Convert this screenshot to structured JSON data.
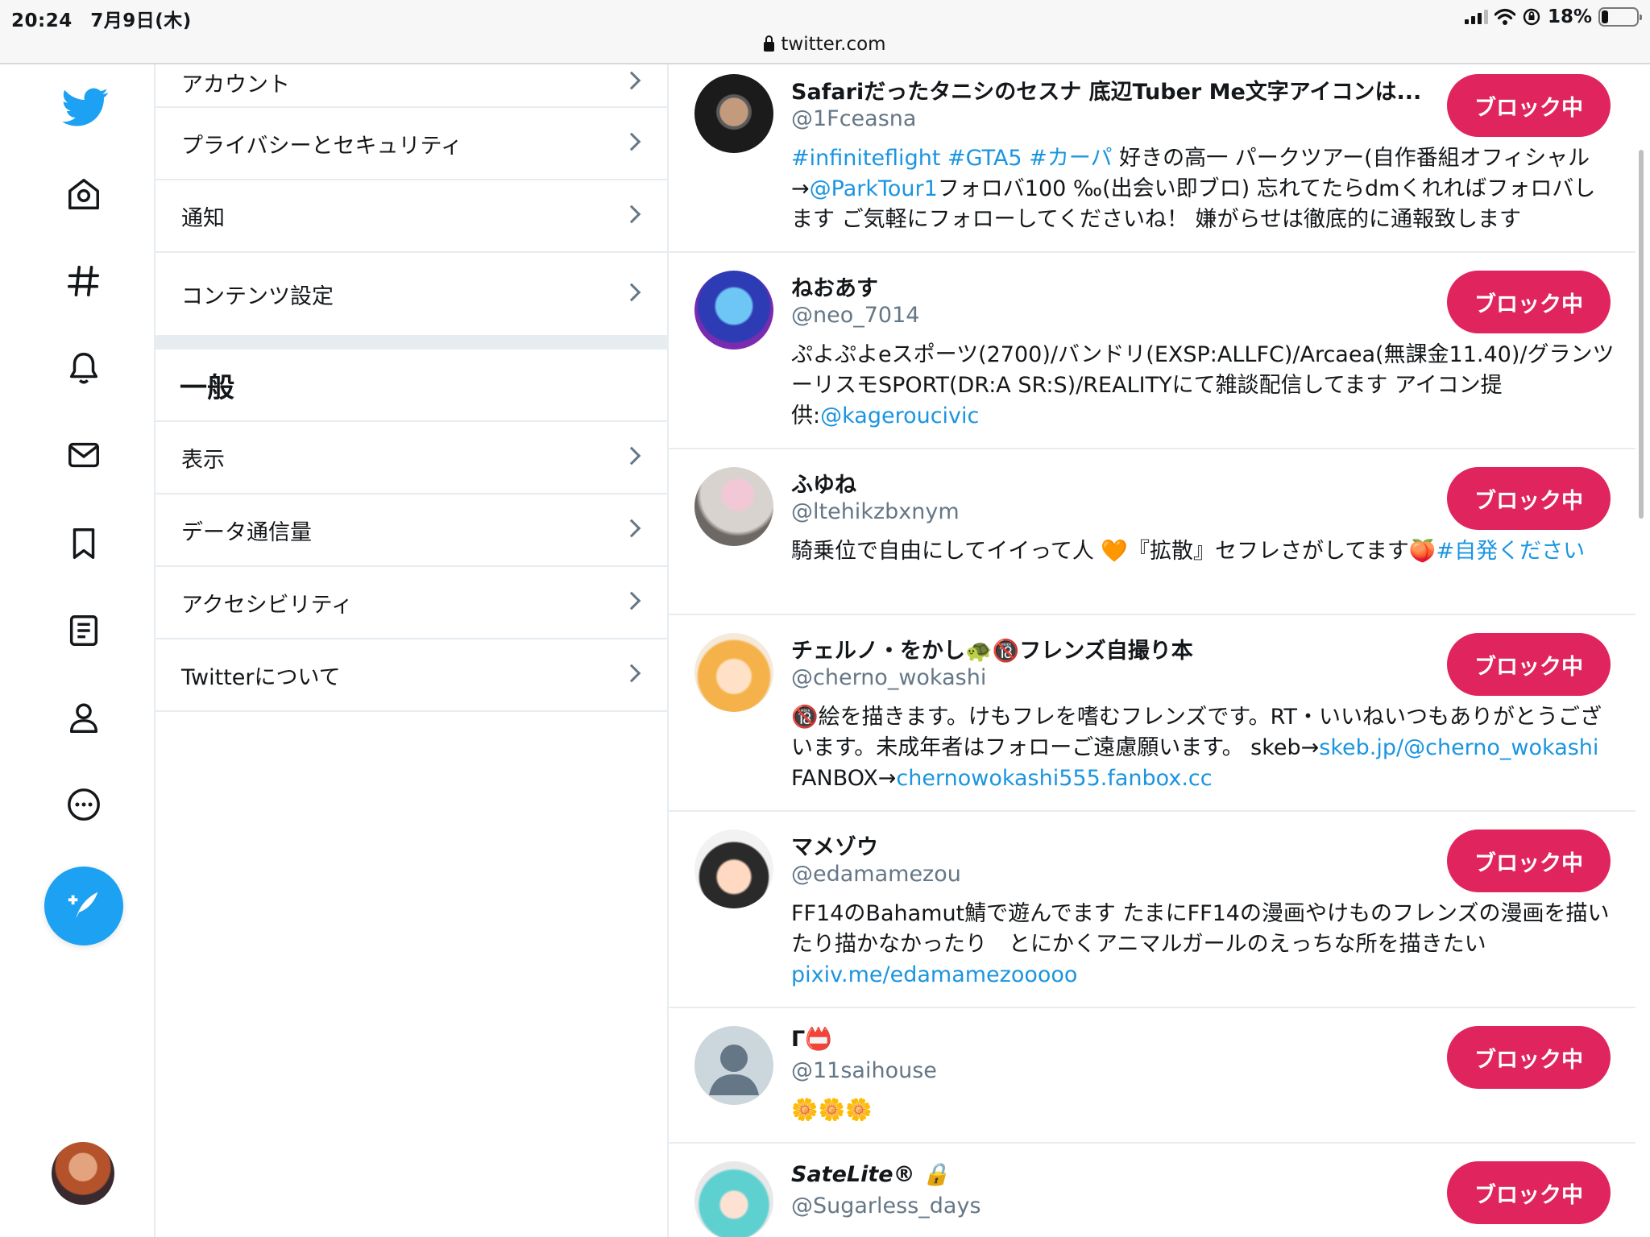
{
  "status_bar": {
    "time": "20:24",
    "date": "7月9日(木)",
    "battery": "18%",
    "battery_level": 0.18,
    "icons": [
      "signal-icon",
      "wifi-icon",
      "orientation-lock-icon",
      "battery-icon"
    ]
  },
  "browser": {
    "url": "twitter.com"
  },
  "nav": {
    "icons": [
      "twitter-logo-icon",
      "home-icon",
      "explore-hashtag-icon",
      "notifications-bell-icon",
      "messages-envelope-icon",
      "bookmarks-icon",
      "lists-icon",
      "profile-icon",
      "more-icon",
      "compose-tweet-icon",
      "account-avatar"
    ]
  },
  "settings": {
    "items_top": [
      "アカウント",
      "プライバシーとセキュリティ",
      "通知",
      "コンテンツ設定"
    ],
    "general_heading": "一般",
    "items_general": [
      "表示",
      "データ通信量",
      "アクセシビリティ",
      "Twitterについて"
    ]
  },
  "blocked": {
    "button_label": "ブロック中",
    "users": [
      {
        "name": "Safariだったタニシのセスナ 底辺Tuber Me文字アイコンは...",
        "handle": "@1Fceasna",
        "bio": [
          {
            "t": "#infiniteflight #GTA5 #カーパ",
            "link": true
          },
          {
            "t": " 好きの高一 パークツアー(自作番組オフィシャル→",
            "link": false
          },
          {
            "t": "@ParkTour1",
            "link": true
          },
          {
            "t": "フォロバ100 ‰(出会い即ブロ) 忘れてたらdmくれればフォロバします ご気軽にフォローしてくださいね！ 嫌がらせは徹底的に通報致します",
            "link": false
          }
        ]
      },
      {
        "name": "ねおあす",
        "handle": "@neo_7014",
        "bio": [
          {
            "t": "ぷよぷよeスポーツ(2700)/バンドリ(EXSP:ALLFC)/Arcaea(無課金11.40)/グランツーリスモSPORT(DR:A SR:S)/REALITYにて雑談配信してます アイコン提供:",
            "link": false
          },
          {
            "t": "@kageroucivic",
            "link": true
          }
        ]
      },
      {
        "name": "ふゆね",
        "handle": "@ltehikzbxnym",
        "bio": [
          {
            "t": "騎乗位で自由にしてイイって人 🧡『拡散』セフレさがしてます🍑",
            "link": false
          },
          {
            "t": "#自発ください",
            "link": true
          }
        ]
      },
      {
        "name": "チェルノ・をかし🐢🔞フレンズ自撮り本",
        "handle": "@cherno_wokashi",
        "bio": [
          {
            "t": "🔞絵を描きます。けもフレを嗜むフレンズです。RT・いいねいつもありがとうございます。未成年者はフォローご遠慮願います。 skeb→",
            "link": false
          },
          {
            "t": "skeb.jp/@cherno_wokashi",
            "link": true
          },
          {
            "t": " FANBOX→",
            "link": false
          },
          {
            "t": "chernowokashi555.fanbox.cc",
            "link": true
          }
        ]
      },
      {
        "name": "マメゾウ",
        "handle": "@edamamezou",
        "bio": [
          {
            "t": "FF14のBahamut鯖で遊んでます たまにFF14の漫画やけものフレンズの漫画を描いたり描かなかったり　とにかくアニマルガールのえっちな所を描きたい ",
            "link": false
          },
          {
            "t": "pixiv.me/edamamezooooo",
            "link": true
          }
        ]
      },
      {
        "name": "Г📛",
        "handle": "@11saihouse",
        "bio": [
          {
            "t": "🌼🌼🌼",
            "link": false
          }
        ]
      },
      {
        "name": "SateLite® 🔒",
        "handle": "@Sugarless_days",
        "bio": []
      }
    ]
  },
  "colors": {
    "twitter_blue": "#1da1f2",
    "block_red": "#e0245e",
    "link_blue": "#1b95e0",
    "secondary_gray": "#657786"
  }
}
